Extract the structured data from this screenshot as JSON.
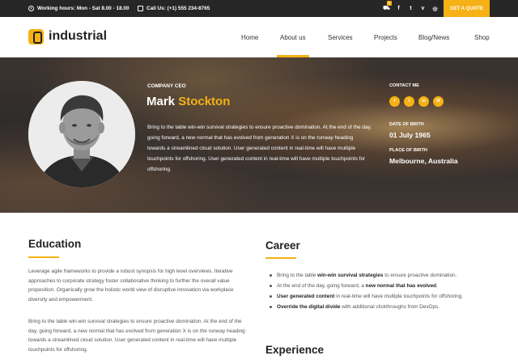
{
  "topbar": {
    "hours": "Working hours:  Mon - Sat 8.00 - 18.00",
    "phone": "Call Us: (+1) 555 234-8765",
    "cart_count": "0",
    "icons": [
      "cart-icon",
      "facebook-icon",
      "twitter-icon",
      "vimeo-icon",
      "instagram-icon",
      "search-icon"
    ],
    "quote_button": "GET A QUOTE"
  },
  "header": {
    "logo_text": "industrial",
    "nav": [
      "Home",
      "About us",
      "Services",
      "Projects",
      "Blog/News",
      "Shop"
    ],
    "active_nav": "About us"
  },
  "profile": {
    "role": "COMPANY CEO",
    "first_name": "Mark",
    "last_name": "Stockton",
    "bio": "Bring to the table win-win survival strategies to ensure proactive domination. At the end of the day, going forward, a new normal that has evolved from generation X is on the runway heading towards a streamlined cloud solution. User generated content in real-time will have multiple touchpoints for offshoring. User generated content in real-time will have multiple touchpoints for offshoring.",
    "contact_label": "CONTACT ME",
    "contact_icons": [
      "facebook-icon",
      "twitter-icon",
      "linkedin-icon",
      "email-icon"
    ],
    "birth_date_label": "DATE OF BIRTH",
    "birth_date": "01 July 1965",
    "birth_place_label": "PLACE OF BIRTH",
    "birth_place": "Melbourne, Australia"
  },
  "education": {
    "title": "Education",
    "p1": "Leverage agile frameworks to provide a robust synopsis for high level overviews. Iterative approaches to corporate strategy foster collaborative thinking to further the overall value proposition. Organically grow the holistic world view of disruptive innovation via workplace diversity and empowerment.",
    "p2": "Bring to the table win-win survival strategies to ensure proactive domination. At the end of the day, going forward, a new normal that has evolved from generation X is on the runway heading towards a streamlined cloud solution. User generated content in real-time will have multiple touchpoints for offshoring."
  },
  "career": {
    "title": "Career",
    "items": [
      {
        "pre": "Bring to the table ",
        "bold": "win-win survival strategies",
        "post": " to ensure proactive domination."
      },
      {
        "pre": "At the end of the day, going forward, a ",
        "bold": "new normal that has evolved",
        "post": "."
      },
      {
        "pre": "",
        "bold": "User generated content",
        "post": " in real-time will have multiple touchpoints for offshoring."
      },
      {
        "pre": "",
        "bold": "Override the digital divide",
        "post": " with additional clickthroughs from DevOps."
      }
    ]
  },
  "experience": {
    "title": "Experience"
  },
  "colors": {
    "accent": "#f5b116",
    "topbar": "#262626",
    "heading": "#222222"
  }
}
